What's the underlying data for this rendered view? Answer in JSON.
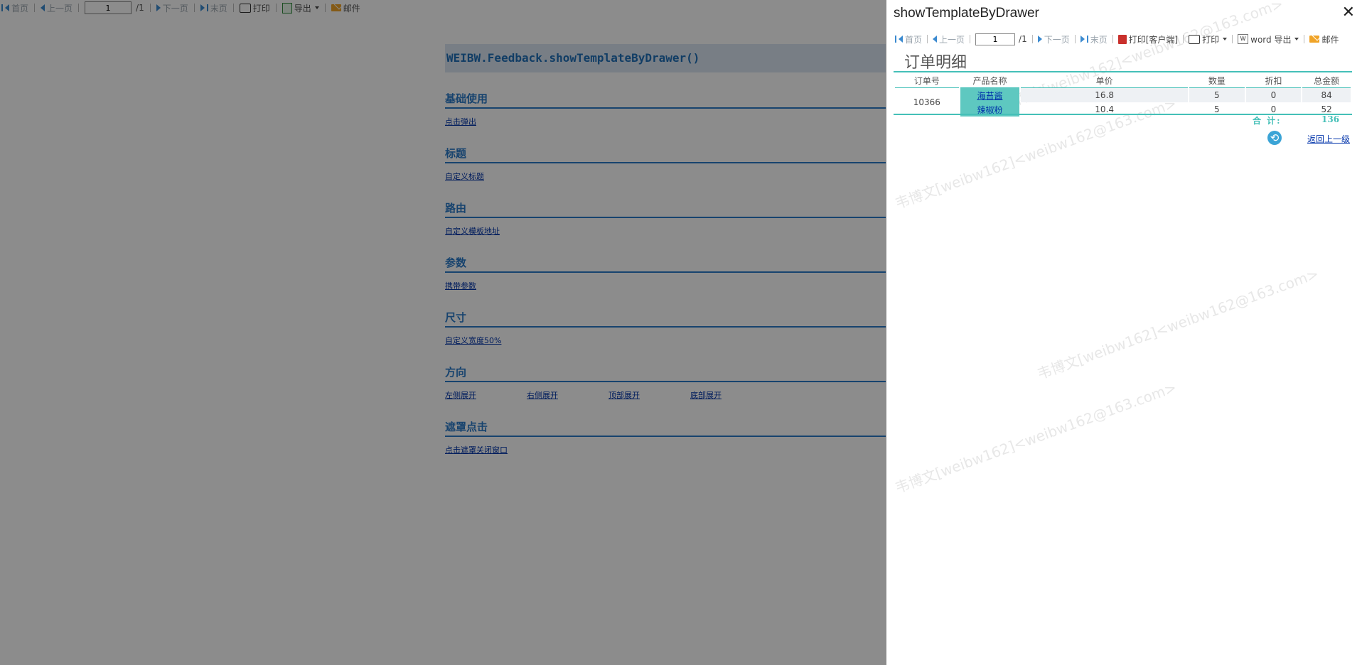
{
  "background_toolbar": {
    "first": "首页",
    "prev": "上一页",
    "page_value": "1",
    "page_total": "/1",
    "next": "下一页",
    "last": "末页",
    "print": "打印",
    "export": "导出",
    "mail": "邮件"
  },
  "page": {
    "title": "WEIBW.Feedback.showTemplateByDrawer()",
    "sections": [
      {
        "title": "基础使用",
        "links": [
          "点击弹出"
        ]
      },
      {
        "title": "标题",
        "links": [
          "自定义标题"
        ]
      },
      {
        "title": "路由",
        "links": [
          "自定义模板地址"
        ]
      },
      {
        "title": "参数",
        "links": [
          "携带参数"
        ]
      },
      {
        "title": "尺寸",
        "links": [
          "自定义宽度50%"
        ]
      },
      {
        "title": "方向",
        "links": [
          "左侧展开",
          "右侧展开",
          "顶部展开",
          "底部展开"
        ]
      },
      {
        "title": "遮罩点击",
        "links": [
          "点击遮罩关闭窗口"
        ]
      }
    ]
  },
  "drawer": {
    "title": "showTemplateByDrawer",
    "toolbar": {
      "first": "首页",
      "prev": "上一页",
      "page_value": "1",
      "page_total": "/1",
      "next": "下一页",
      "last": "末页",
      "print_client": "打印[客户端]",
      "print": "打印",
      "word_export": "word 导出",
      "mail": "邮件"
    },
    "report": {
      "title": "订单明细",
      "headers": [
        "订单号",
        "产品名称",
        "单价",
        "数量",
        "折扣",
        "总金额"
      ],
      "order_no": "10366",
      "rows": [
        {
          "product": "海苔酱",
          "price": "16.8",
          "qty": "5",
          "discount": "0",
          "total": "84"
        },
        {
          "product": "辣椒粉",
          "price": "10.4",
          "qty": "5",
          "discount": "0",
          "total": "52"
        }
      ],
      "total_label": "合 计:",
      "total_value": "136",
      "back_label": "返回上一级"
    },
    "watermark": "韦博文[weibw162]<weibw162@163.com>"
  },
  "colors": {
    "accent": "#2a7ac8",
    "teal": "#45c0b8",
    "product_cell": "#5ec8c0",
    "overlay": "rgba(0,0,0,0.45)"
  }
}
